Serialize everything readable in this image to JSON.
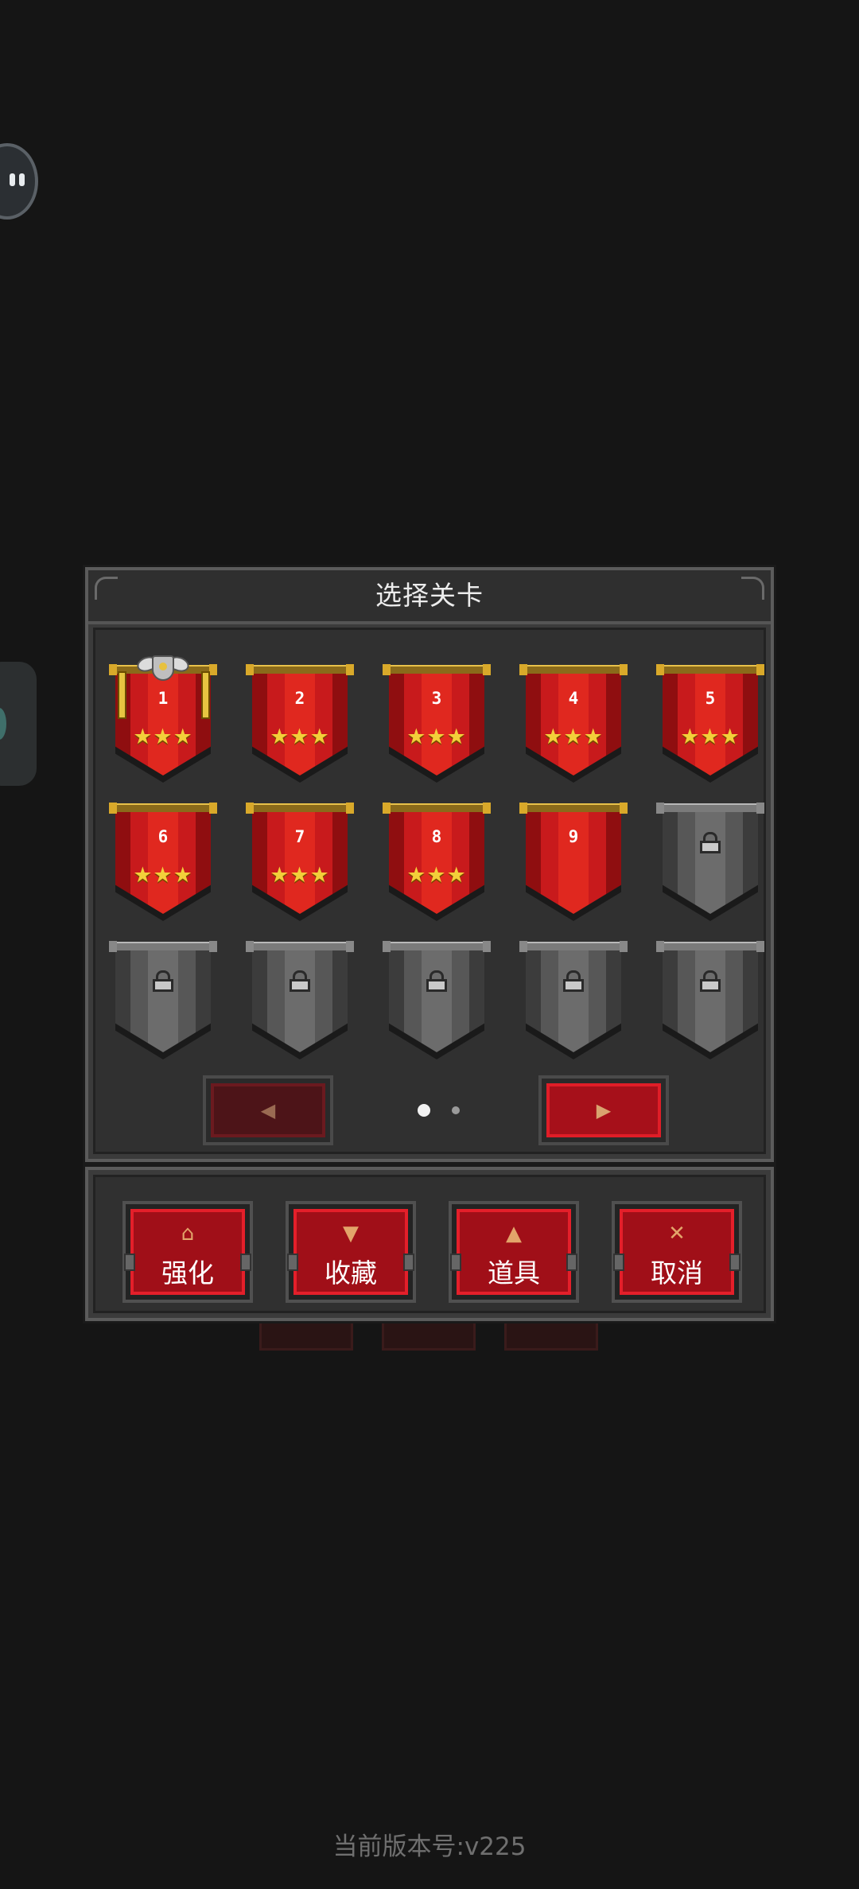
{
  "dialog": {
    "title": "选择关卡"
  },
  "levels": [
    {
      "num": "1",
      "stars": "★★★",
      "state": "cleared",
      "current": true
    },
    {
      "num": "2",
      "stars": "★★★",
      "state": "cleared"
    },
    {
      "num": "3",
      "stars": "★★★",
      "state": "cleared"
    },
    {
      "num": "4",
      "stars": "★★★",
      "state": "cleared"
    },
    {
      "num": "5",
      "stars": "★★★",
      "state": "cleared"
    },
    {
      "num": "6",
      "stars": "★★★",
      "state": "cleared"
    },
    {
      "num": "7",
      "stars": "★★★",
      "state": "cleared"
    },
    {
      "num": "8",
      "stars": "★★★",
      "state": "cleared"
    },
    {
      "num": "9",
      "stars": "",
      "state": "unlocked"
    },
    {
      "num": "",
      "stars": "",
      "state": "locked"
    },
    {
      "num": "",
      "stars": "",
      "state": "locked"
    },
    {
      "num": "",
      "stars": "",
      "state": "locked"
    },
    {
      "num": "",
      "stars": "",
      "state": "locked"
    },
    {
      "num": "",
      "stars": "",
      "state": "locked"
    },
    {
      "num": "",
      "stars": "",
      "state": "locked"
    }
  ],
  "pager": {
    "prev_icon": "◀",
    "next_icon": "▶",
    "current_page": 1,
    "total_pages": 2
  },
  "toolbar": [
    {
      "icon": "⌂",
      "icon_name": "upgrade-icon",
      "label": "强化"
    },
    {
      "icon": "▼",
      "icon_name": "trophy-icon",
      "label": "收藏"
    },
    {
      "icon": "▲",
      "icon_name": "potion-icon",
      "label": "道具"
    },
    {
      "icon": "✕",
      "icon_name": "close-icon",
      "label": "取消"
    }
  ],
  "footer": {
    "version": "当前版本号:v225"
  },
  "colors": {
    "background": "#151515",
    "button_red": "#a00f18",
    "star_gold": "#f3cf3a"
  }
}
